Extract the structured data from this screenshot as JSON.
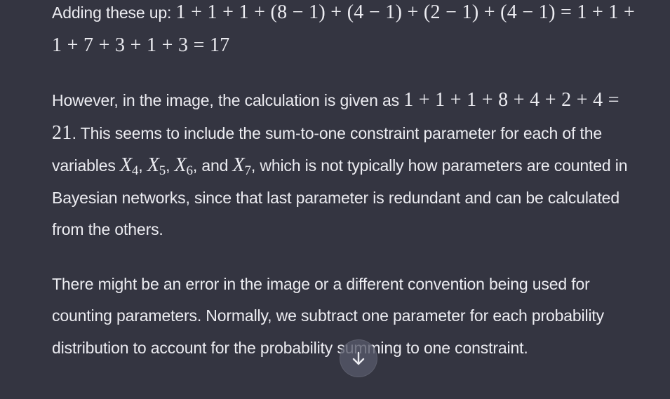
{
  "message": {
    "p1": {
      "lead": "Adding these up: ",
      "math": "1 + 1 + 1 + (8 − 1) + (4 − 1) + (2 − 1) + (4 − 1) = 1 + 1 + 1 + 7 + 3 + 1 + 3 = 17"
    },
    "p2": {
      "t1": "However, in the image, the calculation is given as ",
      "math": "1 + 1 + 1 + 8 + 4 + 2 + 4 = 21",
      "t2": ". This seems to include the sum-to-one constraint parameter for each of the variables ",
      "v4": "X",
      "v4_sub": "4",
      "sep1": ", ",
      "v5": "X",
      "v5_sub": "5",
      "sep2": ", ",
      "v6": "X",
      "v6_sub": "6",
      "sep3": ", and ",
      "v7": "X",
      "v7_sub": "7",
      "t3": ", which is not typically how parameters are counted in Bayesian networks, since that last parameter is redundant and can be calculated from the others."
    },
    "p3": {
      "text": "There might be an error in the image or a different convention being used for counting parameters. Normally, we subtract one parameter for each probability distribution to account for the probability summing to one constraint."
    }
  },
  "scroll_button": {
    "icon": "arrow-down-icon"
  },
  "colors": {
    "background": "#343541",
    "text": "#ececf1",
    "button": "#565869"
  }
}
